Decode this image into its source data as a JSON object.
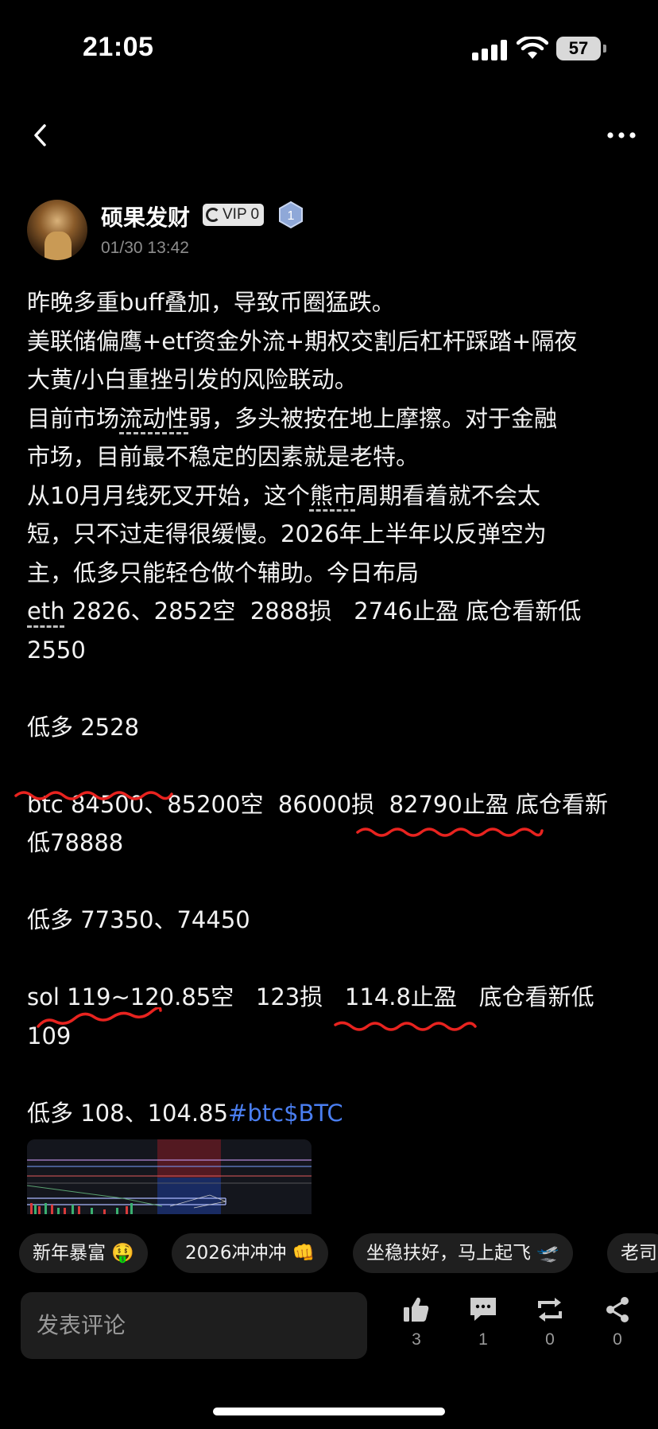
{
  "status_bar": {
    "time": "21:05",
    "battery": "57"
  },
  "post": {
    "author": "硕果发财",
    "vip_badge": "VIP 0",
    "level": "1",
    "date": "01/30 13:42",
    "lines": [
      "昨晚多重buff叠加，导致币圈猛跌。",
      "美联储偏鹰+etf资金外流+期权交割后杠杆踩踏+隔夜",
      "大黄/小白重挫引发的风险联动。",
      "目前市场",
      "流动性",
      "弱，多头被按在地上摩擦。对于金融",
      "市场，目前最不稳定的因素就是老特。",
      "从10月月线死叉开始，这个",
      "熊市",
      "周期看着就不会太",
      "短，只不过走得很缓慢。2026年上半年以反弹空为",
      "主，低多只能轻仓做个辅助。今日布局",
      "eth",
      " 2826、2852空  2888损   2746止盈 底仓看新低",
      "2550",
      "低多 2528",
      "btc 84500、85200空  86000损  82790止盈 底仓看新",
      "低78888",
      "低多 77350、74450",
      "sol 119~120.85空   123损   114.8止盈   底仓看新低",
      "109",
      "低多 108、104.85",
      "#btc$BTC"
    ]
  },
  "chips": [
    "新年暴富 🤑",
    "2026冲冲冲 👊",
    "坐稳扶好，马上起飞 🛫",
    "老司"
  ],
  "bottom_bar": {
    "comment_placeholder": "发表评论",
    "like_count": "3",
    "comment_count": "1",
    "repost_count": "0",
    "share_count": "0"
  },
  "colors": {
    "background": "#000000",
    "hashtag": "#4a7ef0",
    "annotation": "#e8231f"
  }
}
